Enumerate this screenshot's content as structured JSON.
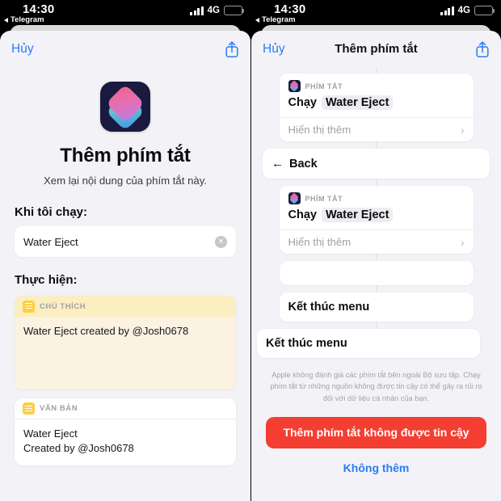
{
  "status_bar": {
    "time": "14:30",
    "back_app": "Telegram",
    "network": "4G",
    "signal_icon": "signal-bars-icon",
    "battery_icon": "battery-low-power-icon",
    "battery_color": "#f7d417"
  },
  "colors": {
    "accent_blue": "#2a7cf7",
    "danger_red": "#f53e32",
    "page_bg": "#f3f2f7",
    "comment_yellow": "#fbeec0",
    "comment_body": "#fcf2e2"
  },
  "left": {
    "nav": {
      "cancel_label": "Hủy",
      "share_icon": "share-icon"
    },
    "app_icon": "shortcuts-app-icon",
    "title": "Thêm phím tắt",
    "subtitle": "Xem lại nội dung của phím tắt này.",
    "run_section": {
      "label": "Khi tôi chạy:",
      "value": "Water Eject",
      "clear_icon": "clear-field-icon"
    },
    "do_section": {
      "label": "Thực hiện:"
    },
    "cards": [
      {
        "kind": "comment",
        "header_icon": "document-icon",
        "header_label": "CHÚ THÍCH",
        "body": "Water Eject created by @Josh0678"
      },
      {
        "kind": "text",
        "header_icon": "document-icon",
        "header_label": "VĂN BẢN",
        "body_line1": "Water Eject",
        "body_line2": "Created by @Josh0678"
      }
    ]
  },
  "right": {
    "nav": {
      "cancel_label": "Hủy",
      "title": "Thêm phím tắt",
      "share_icon": "share-icon"
    },
    "actions": [
      {
        "type": "shortcut",
        "icon": "shortcuts-app-icon",
        "header_label": "PHÍM TẮT",
        "verb": "Chạy",
        "param": "Water Eject",
        "more_label": "Hiển thị thêm",
        "chevron_icon": "chevron-right-icon"
      },
      {
        "type": "back",
        "arrow_icon": "arrow-left-icon",
        "label": "Back"
      },
      {
        "type": "shortcut",
        "icon": "shortcuts-app-icon",
        "header_label": "PHÍM TẮT",
        "verb": "Chạy",
        "param": "Water Eject",
        "more_label": "Hiển thị thêm",
        "chevron_icon": "chevron-right-icon"
      },
      {
        "type": "empty",
        "label": ""
      },
      {
        "type": "simple",
        "label": "Kết thúc menu"
      },
      {
        "type": "simple-wide",
        "label": "Kết thúc menu"
      }
    ],
    "disclaimer": "Apple không đánh giá các phím tắt bên ngoài Bộ sưu tập. Chạy phím tắt từ những nguồn không được tin cậy có thể gây ra rủi ro đối với dữ liệu cá nhân của bạn.",
    "primary_button": "Thêm phím tắt không được tin cậy",
    "secondary_button": "Không thêm"
  }
}
